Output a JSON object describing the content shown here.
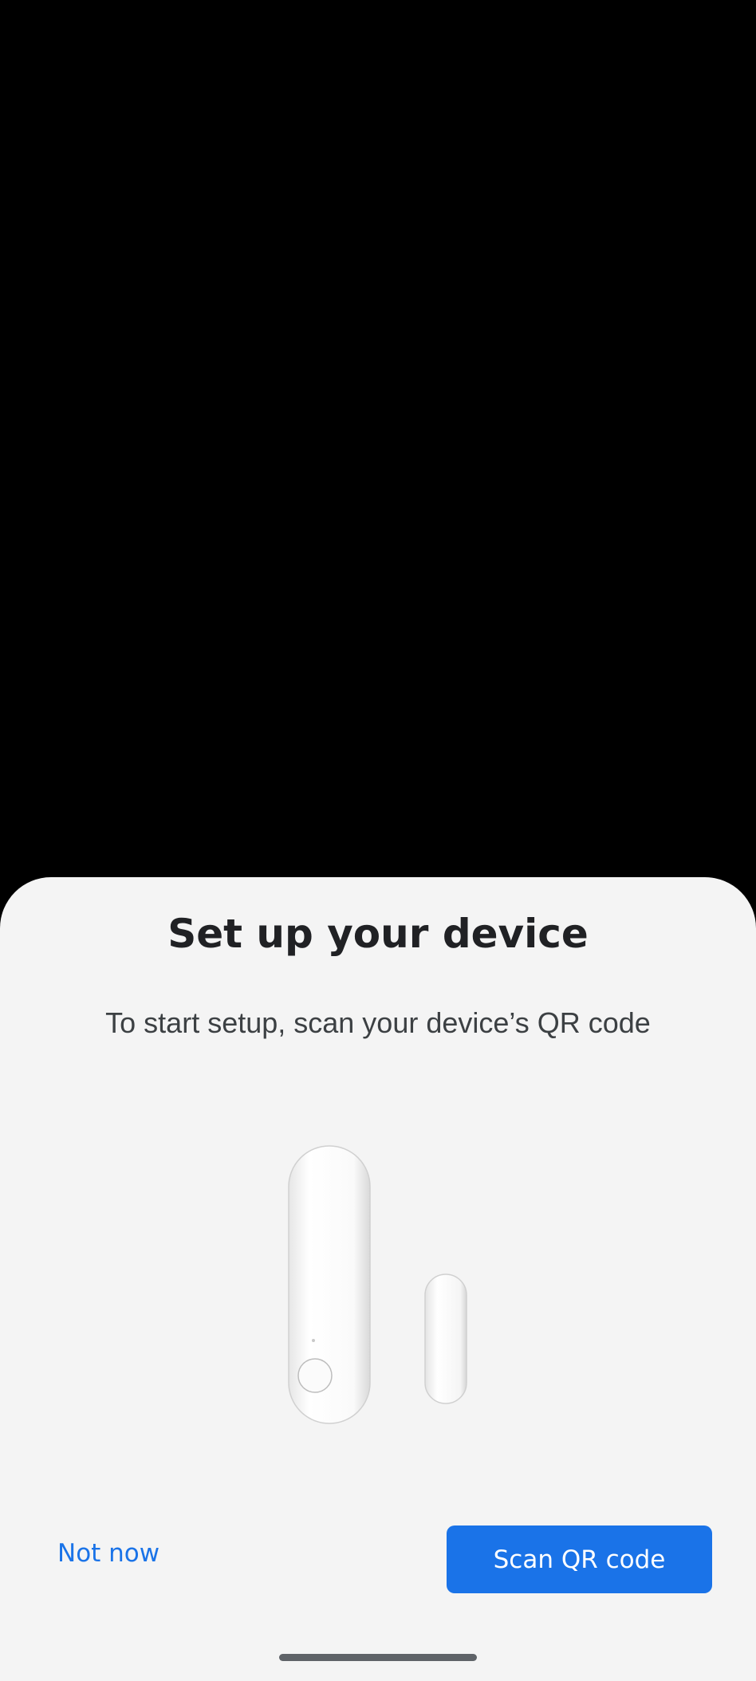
{
  "sheet": {
    "title": "Set up your device",
    "subtitle": "To start setup, scan your device’s QR code",
    "illustration": "door-window-sensor-illustration"
  },
  "actions": {
    "secondary_label": "Not now",
    "primary_label": "Scan QR code"
  },
  "colors": {
    "accent": "#1a73e8",
    "sheet_background": "#f4f4f4",
    "backdrop": "#000000"
  }
}
